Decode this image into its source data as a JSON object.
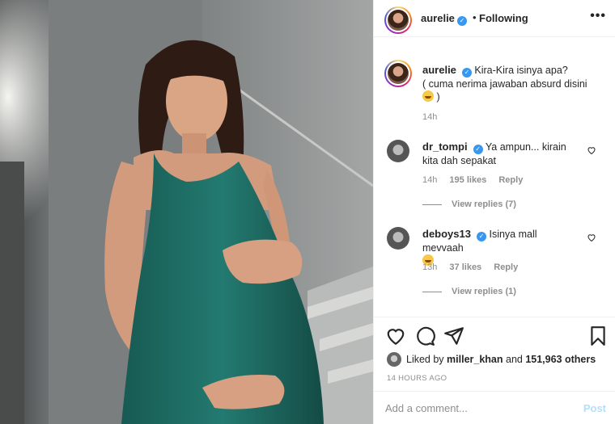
{
  "header": {
    "username": "aurelie",
    "separator": "•",
    "follow_status": "Following",
    "more_icon": "more-horizontal-icon"
  },
  "caption": {
    "username": "aurelie",
    "text_line1": "Kira-Kira isinya apa?",
    "text_line2": "( cuma nerima jawaban absurd disini",
    "text_end": " )",
    "time": "14h"
  },
  "comments": [
    {
      "username": "dr_tompi",
      "text": "Ya ampun... kirain kita dah sepakat",
      "time": "14h",
      "likes": "195 likes",
      "reply": "Reply",
      "view_replies": "View replies (7)"
    },
    {
      "username": "deboys13",
      "text": "Isinya mall mevvaah",
      "time": "13h",
      "likes": "37 likes",
      "reply": "Reply",
      "view_replies": "View replies (1)"
    }
  ],
  "actions": {
    "liked_by_prefix": "Liked by ",
    "liked_by_user": "miller_khan",
    "liked_by_and": " and ",
    "liked_by_count": "151,963 others",
    "post_time": "14 HOURS AGO",
    "comment_placeholder": "Add a comment...",
    "post_label": "Post"
  },
  "colors": {
    "verified": "#3897f0",
    "post_disabled": "#b2dffc",
    "dress": "#1f6f66"
  }
}
